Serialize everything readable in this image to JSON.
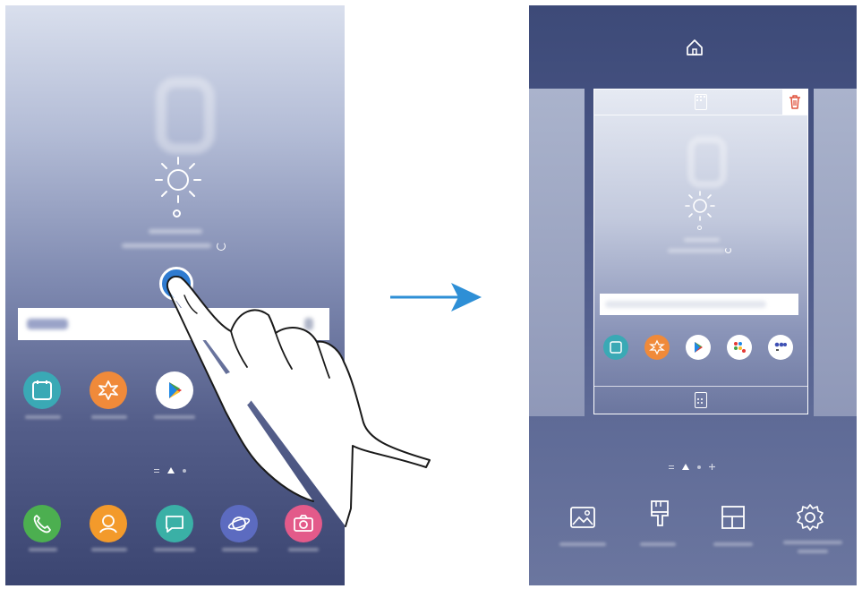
{
  "left_screen": {
    "home_apps_row": [
      {
        "icon": "calendar-icon",
        "color": "#3aa9b5"
      },
      {
        "icon": "gallery-flower-icon",
        "color": "#f08a3a"
      },
      {
        "icon": "play-store-icon",
        "color": "#ffffff"
      },
      {
        "icon": "google-folder-icon",
        "color": "#ffffff"
      }
    ],
    "dock_apps": [
      {
        "icon": "phone-icon",
        "color": "#4caf50"
      },
      {
        "icon": "contacts-icon",
        "color": "#f39a2b"
      },
      {
        "icon": "messages-icon",
        "color": "#3ab0a6"
      },
      {
        "icon": "internet-icon",
        "color": "#5c6bc0"
      },
      {
        "icon": "camera-icon",
        "color": "#e35a8a"
      }
    ]
  },
  "right_screen": {
    "top_icon": "home-icon",
    "card_apps": [
      {
        "icon": "calendar-icon",
        "color": "#3aa9b5"
      },
      {
        "icon": "gallery-flower-icon",
        "color": "#f08a3a"
      },
      {
        "icon": "play-store-icon",
        "color": "#ffffff"
      },
      {
        "icon": "google-folder-icon",
        "color": "#ffffff"
      },
      {
        "icon": "samsung-folder-icon",
        "color": "#ffffff"
      }
    ],
    "bottom_tools": [
      {
        "icon": "wallpapers-icon"
      },
      {
        "icon": "themes-icon"
      },
      {
        "icon": "widgets-icon"
      },
      {
        "icon": "settings-icon"
      }
    ]
  },
  "colors": {
    "accent": "#2f7bd0",
    "arrow": "#2e8fd6",
    "delete": "#e0533e"
  }
}
